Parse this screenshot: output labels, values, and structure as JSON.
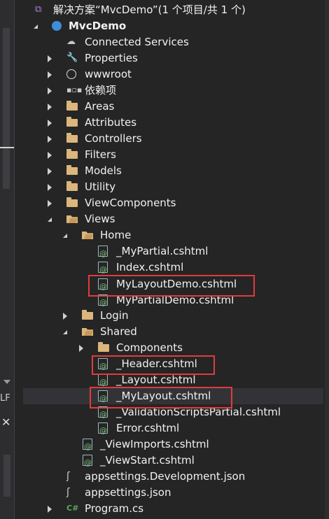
{
  "solution": {
    "title": "解决方案“MvcDemo”(1 个项目/共 1 个)"
  },
  "project": {
    "name": "MvcDemo"
  },
  "tree": {
    "connected_services": "Connected Services",
    "properties": "Properties",
    "wwwroot": "wwwroot",
    "dependencies": "依赖项",
    "areas": "Areas",
    "attributes": "Attributes",
    "controllers": "Controllers",
    "filters": "Filters",
    "models": "Models",
    "utility": "Utility",
    "viewcomponents": "ViewComponents",
    "views": "Views",
    "home": "Home",
    "mypartial": "_MyPartial.cshtml",
    "index": "Index.cshtml",
    "mylayoutdemo": "MyLayoutDemo.cshtml",
    "mypartialdemo": "MyPartialDemo.cshtml",
    "login": "Login",
    "shared": "Shared",
    "components": "Components",
    "header": "_Header.cshtml",
    "layout": "_Layout.cshtml",
    "mylayout": "_MyLayout.cshtml",
    "validation": "_ValidationScriptsPartial.cshtml",
    "error": "Error.cshtml",
    "viewimports": "_ViewImports.cshtml",
    "viewstart": "_ViewStart.cshtml",
    "appsettings_dev": "appsettings.Development.json",
    "appsettings": "appsettings.json",
    "program": "Program.cs"
  },
  "left_panel": {
    "fragment_lf": "LF",
    "close": "✕"
  },
  "colors": {
    "highlight_box": "#e23b3b",
    "folder": "#dcb67a",
    "background": "#252526"
  }
}
